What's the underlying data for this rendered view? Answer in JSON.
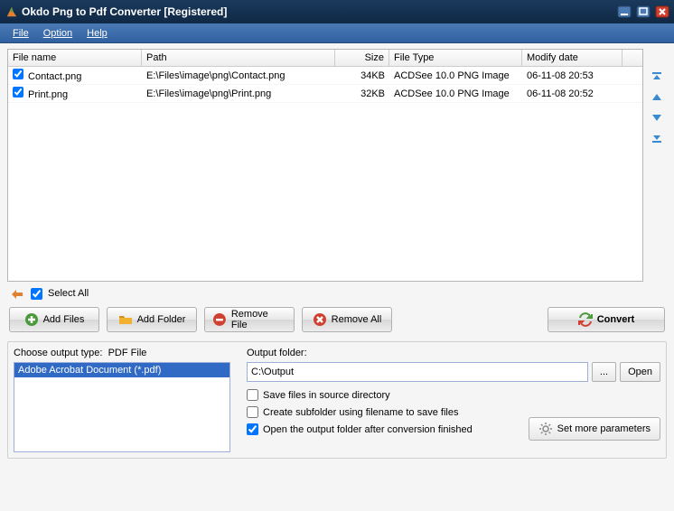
{
  "window": {
    "title": "Okdo Png to Pdf Converter [Registered]"
  },
  "menu": {
    "file": "File",
    "option": "Option",
    "help": "Help"
  },
  "table": {
    "headers": {
      "filename": "File name",
      "path": "Path",
      "size": "Size",
      "filetype": "File Type",
      "modifydate": "Modify date"
    },
    "rows": [
      {
        "checked": true,
        "name": "Contact.png",
        "path": "E:\\Files\\image\\png\\Contact.png",
        "size": "34KB",
        "type": "ACDSee 10.0 PNG Image",
        "date": "06-11-08 20:53"
      },
      {
        "checked": true,
        "name": "Print.png",
        "path": "E:\\Files\\image\\png\\Print.png",
        "size": "32KB",
        "type": "ACDSee 10.0 PNG Image",
        "date": "06-11-08 20:52"
      }
    ]
  },
  "selectall": "Select All",
  "buttons": {
    "addfiles": "Add Files",
    "addfolder": "Add Folder",
    "removefile": "Remove File",
    "removeall": "Remove All",
    "convert": "Convert"
  },
  "output": {
    "type_label": "Choose output type:",
    "type_value": "PDF File",
    "selected_format": "Adobe Acrobat Document (*.pdf)",
    "folder_label": "Output folder:",
    "folder_value": "C:\\Output",
    "browse": "...",
    "open": "Open",
    "save_source": "Save files in source directory",
    "create_subfolder": "Create subfolder using filename to save files",
    "open_after": "Open the output folder after conversion finished",
    "more_params": "Set more parameters"
  }
}
